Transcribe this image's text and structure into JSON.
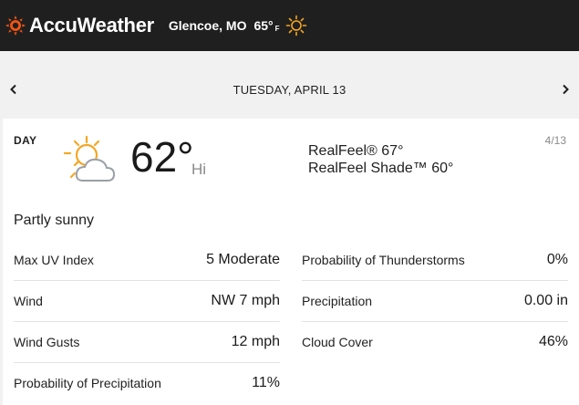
{
  "header": {
    "brand": "AccuWeather",
    "location": "Glencoe, MO",
    "current_temp": "65°",
    "unit": "F",
    "logo_icon": "accuweather-sun-logo-icon",
    "current_icon": "sunny-icon",
    "brand_color": "#f05514"
  },
  "day_nav": {
    "prev_icon": "chevron-left-icon",
    "date": "TUESDAY, APRIL 13",
    "next_icon": "chevron-right-icon"
  },
  "card": {
    "label": "DAY",
    "date": "4/13",
    "icon": "partly-sunny-icon",
    "temperature": "62°",
    "temp_label": "Hi",
    "realfeel": "RealFeel® 67°",
    "realfeel_shade": "RealFeel Shade™ 60°",
    "phrase": "Partly sunny"
  },
  "details": {
    "left": [
      {
        "label": "Max UV Index",
        "value": "5 Moderate"
      },
      {
        "label": "Wind",
        "value": "NW 7 mph"
      },
      {
        "label": "Wind Gusts",
        "value": "12 mph"
      },
      {
        "label": "Probability of Precipitation",
        "value": "11%"
      }
    ],
    "right": [
      {
        "label": "Probability of Thunderstorms",
        "value": "0%"
      },
      {
        "label": "Precipitation",
        "value": "0.00 in"
      },
      {
        "label": "Cloud Cover",
        "value": "46%"
      }
    ]
  }
}
